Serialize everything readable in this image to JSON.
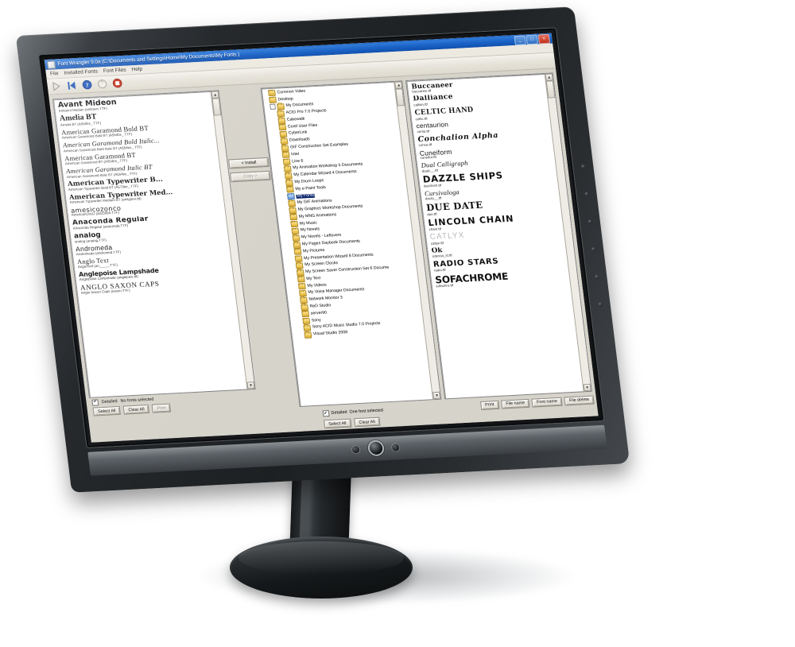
{
  "window": {
    "title": "Font Wrangler 9.0a (C:\\Documents and Settings\\Home\\My Documents\\My Fonts )",
    "minimize_label": "_",
    "maximize_label": "□",
    "close_label": "×",
    "app_icon": "font-app-icon"
  },
  "menu": {
    "items": [
      "File",
      "Installed Fonts",
      "Font Files",
      "Help"
    ]
  },
  "toolbar": {
    "items": [
      {
        "name": "forward-arrow-icon",
        "glyph": "▶",
        "enabled": false
      },
      {
        "name": "back-to-start-icon",
        "glyph": "◀|",
        "enabled": true
      },
      {
        "name": "help-icon",
        "glyph": "?",
        "enabled": true
      },
      {
        "name": "refresh-icon",
        "glyph": "↻",
        "enabled": false
      },
      {
        "name": "stop-icon",
        "glyph": "■",
        "enabled": true
      }
    ]
  },
  "installed_panel": {
    "fonts": [
      {
        "name": "Avant Mideon",
        "meta": "Ambient Median (ambavn.TTF)"
      },
      {
        "name": "Amelia BT",
        "meta": "Amelia BT (A550bs_.TTF)"
      },
      {
        "name": "American Garamond Bold BT",
        "meta": "American Garamond Bold BT (A554bs_.TTF)"
      },
      {
        "name": "American Garamond Bold Italic...",
        "meta": "American Garamond Bold Italic BT (A554bs_.TTF)"
      },
      {
        "name": "American Garamond BT",
        "meta": "American Garamond BT (A554bs_.TTF)"
      },
      {
        "name": "American Garamond Italic BT",
        "meta": "American Garamond Italic BT (A554bs_.TTF)"
      },
      {
        "name": "American Typewriter B...",
        "meta": "American Typewriter Bold BT (A573be_.TTF)"
      },
      {
        "name": "American Typewriter Med...",
        "meta": "American Typewriter Medium BT (amtypen.ttf)"
      },
      {
        "name": "amesicozonco",
        "meta": "AmericanUncD (a0256b0.TTF)"
      },
      {
        "name": "Anaconda Regular",
        "meta": "Anaconda Regular (anaconda.TTF)"
      },
      {
        "name": "analog",
        "meta": "analog (analog.TTF)"
      },
      {
        "name": "Andromeda",
        "meta": "Andromeda (andromed.TTF)"
      },
      {
        "name": "Anglo Text",
        "meta": "AngloText (an_____.TTF)"
      },
      {
        "name": "Anglepoise Lampshade",
        "meta": "Anglepoise Lampshade (anglepois.ttf)"
      },
      {
        "name": "ANGLO SAXON CAPS",
        "meta": "Anglo Saxon Caps (saxon.TTF)"
      }
    ],
    "status": {
      "detailed_label": "Detailed",
      "detailed_checked": true,
      "selection_text": "No fonts selected"
    },
    "buttons": [
      "Select All",
      "Clear All",
      "Print"
    ]
  },
  "transfer_buttons": [
    {
      "label": "< Install",
      "enabled": true
    },
    {
      "label": "Copy >",
      "enabled": false
    }
  ],
  "folder_tree": {
    "nodes": [
      {
        "label": "Common Video",
        "indent": 0,
        "open": false,
        "selected": false,
        "expander": ""
      },
      {
        "label": "Desktop",
        "indent": 0,
        "open": false,
        "selected": false,
        "expander": ""
      },
      {
        "label": "My Documents",
        "indent": 0,
        "open": false,
        "selected": false,
        "expander": "-"
      },
      {
        "label": "ACID Pro 7.0 Projects",
        "indent": 1,
        "open": false,
        "selected": false,
        "expander": ""
      },
      {
        "label": "Cakewalk",
        "indent": 1,
        "open": false,
        "selected": false,
        "expander": ""
      },
      {
        "label": "Corel User Files",
        "indent": 1,
        "open": false,
        "selected": false,
        "expander": ""
      },
      {
        "label": "CyberLink",
        "indent": 1,
        "open": false,
        "selected": false,
        "expander": ""
      },
      {
        "label": "Downloads",
        "indent": 1,
        "open": false,
        "selected": false,
        "expander": ""
      },
      {
        "label": "GIF Construction Set Examples",
        "indent": 1,
        "open": false,
        "selected": false,
        "expander": ""
      },
      {
        "label": "Intel",
        "indent": 1,
        "open": false,
        "selected": false,
        "expander": ""
      },
      {
        "label": "Line 6",
        "indent": 1,
        "open": false,
        "selected": false,
        "expander": ""
      },
      {
        "label": "My Animation Workshop 5 Documents",
        "indent": 1,
        "open": false,
        "selected": false,
        "expander": ""
      },
      {
        "label": "My Calendar Wizard 4 Documents",
        "indent": 1,
        "open": false,
        "selected": false,
        "expander": ""
      },
      {
        "label": "My Drum Loops",
        "indent": 1,
        "open": false,
        "selected": false,
        "expander": ""
      },
      {
        "label": "My e-Paint Tools",
        "indent": 1,
        "open": false,
        "selected": false,
        "expander": ""
      },
      {
        "label": "My Fonts",
        "indent": 1,
        "open": true,
        "selected": true,
        "expander": ""
      },
      {
        "label": "My GIF Animations",
        "indent": 1,
        "open": false,
        "selected": false,
        "expander": ""
      },
      {
        "label": "My Graphics Workshop Documents",
        "indent": 1,
        "open": false,
        "selected": false,
        "expander": ""
      },
      {
        "label": "My MNG Animations",
        "indent": 1,
        "open": false,
        "selected": false,
        "expander": ""
      },
      {
        "label": "My Music",
        "indent": 1,
        "open": false,
        "selected": false,
        "expander": ""
      },
      {
        "label": "My Novels",
        "indent": 1,
        "open": false,
        "selected": false,
        "expander": ""
      },
      {
        "label": "My Novels - Leftovers",
        "indent": 1,
        "open": false,
        "selected": false,
        "expander": ""
      },
      {
        "label": "My Pages Daybook Documents",
        "indent": 1,
        "open": false,
        "selected": false,
        "expander": ""
      },
      {
        "label": "My Pictures",
        "indent": 1,
        "open": false,
        "selected": false,
        "expander": ""
      },
      {
        "label": "My Presentation Wizard 8 Documents",
        "indent": 1,
        "open": false,
        "selected": false,
        "expander": ""
      },
      {
        "label": "My Screen Clocks",
        "indent": 1,
        "open": false,
        "selected": false,
        "expander": ""
      },
      {
        "label": "My Screen Saver Construction Set 6 Docume",
        "indent": 1,
        "open": false,
        "selected": false,
        "expander": ""
      },
      {
        "label": "My Text",
        "indent": 1,
        "open": false,
        "selected": false,
        "expander": ""
      },
      {
        "label": "My Videos",
        "indent": 1,
        "open": false,
        "selected": false,
        "expander": ""
      },
      {
        "label": "My Voice Manager Documents",
        "indent": 1,
        "open": false,
        "selected": false,
        "expander": ""
      },
      {
        "label": "Network Monitor 3",
        "indent": 1,
        "open": false,
        "selected": false,
        "expander": ""
      },
      {
        "label": "ReD Studio",
        "indent": 1,
        "open": false,
        "selected": false,
        "expander": ""
      },
      {
        "label": "server90",
        "indent": 1,
        "open": false,
        "selected": false,
        "expander": ""
      },
      {
        "label": "Sony",
        "indent": 1,
        "open": false,
        "selected": false,
        "expander": ""
      },
      {
        "label": "Sony ACID Music Studio 7.0 Projects",
        "indent": 1,
        "open": false,
        "selected": false,
        "expander": ""
      },
      {
        "label": "Visual Studio 2008",
        "indent": 1,
        "open": false,
        "selected": false,
        "expander": ""
      }
    ]
  },
  "files_panel": {
    "fonts": [
      {
        "name": "Buccaneer",
        "meta": "buccanee.ttf"
      },
      {
        "name": "Dalliance",
        "meta": "callian.ttf"
      },
      {
        "name": "CELTIC HAND",
        "meta": "celtic.ttf"
      },
      {
        "name": "centaurion",
        "meta": "centa.ttf"
      },
      {
        "name": "Conchalion Alpha",
        "meta": "conca.ttf"
      },
      {
        "name": "Cuneiform",
        "meta": "cuneifor.ttf"
      },
      {
        "name": "Dual Calligraph",
        "meta": "dualc__.ttf"
      },
      {
        "name": "DAZZLE SHIPS",
        "meta": "dazzlesh.ttf"
      },
      {
        "name": "Cursivaloga",
        "meta": "dacta__.ttf"
      },
      {
        "name": "DUE DATE",
        "meta": "due.ttf"
      },
      {
        "name": "LINCOLN CHAIN",
        "meta": "chain.ttf"
      },
      {
        "name": "CATLYX",
        "meta": "catlyx.ttf"
      },
      {
        "name": "Ok",
        "meta": "odessa_st.ttf"
      },
      {
        "name": "RADIO STARS",
        "meta": "radio.ttf"
      },
      {
        "name": "SOFACHROME",
        "meta": "sofachro.ttf"
      }
    ],
    "status": {
      "detailed_label": "Detailed",
      "detailed_checked": true,
      "selection_text": "One font selected"
    },
    "top_buttons": [
      "Print",
      "File name",
      "Font name",
      "File delete"
    ],
    "bottom_buttons": [
      "Select All",
      "Clear All"
    ]
  }
}
